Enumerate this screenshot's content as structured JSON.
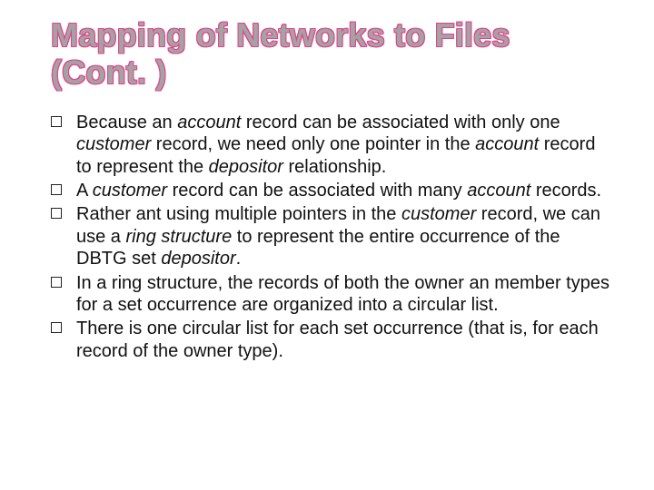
{
  "title": "Mapping of Networks to Files (Cont. )",
  "bullets": [
    {
      "runs": [
        {
          "t": "Because an "
        },
        {
          "t": "account",
          "i": true
        },
        {
          "t": " record can be associated with only one "
        },
        {
          "t": "customer",
          "i": true
        },
        {
          "t": " record, we need only one pointer in the "
        },
        {
          "t": "account ",
          "i": true
        },
        {
          "t": " record to represent the "
        },
        {
          "t": "depositor",
          "i": true
        },
        {
          "t": " relationship."
        }
      ]
    },
    {
      "runs": [
        {
          "t": "A "
        },
        {
          "t": "customer",
          "i": true
        },
        {
          "t": " record can be associated with many "
        },
        {
          "t": "account",
          "i": true
        },
        {
          "t": " records."
        }
      ]
    },
    {
      "runs": [
        {
          "t": "Rather ant using multiple pointers in the "
        },
        {
          "t": "customer",
          "i": true
        },
        {
          "t": " record, we can use a "
        },
        {
          "t": "ring structure",
          "i": true
        },
        {
          "t": " to represent the entire occurrence of the DBTG set "
        },
        {
          "t": "depositor",
          "i": true
        },
        {
          "t": "."
        }
      ]
    },
    {
      "runs": [
        {
          "t": "In a ring structure, the records of both the owner an member types for a set occurrence are organized into a circular list."
        }
      ]
    },
    {
      "runs": [
        {
          "t": "There is one circular list for each set occurrence (that is, for each record of the owner type)."
        }
      ]
    }
  ]
}
